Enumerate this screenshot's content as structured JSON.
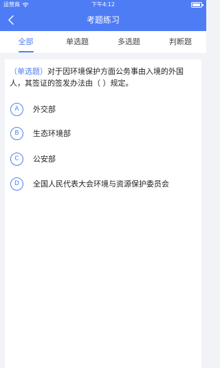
{
  "status_bar": {
    "carrier": "运营商",
    "time": "下午4:12"
  },
  "nav": {
    "title": "考题练习"
  },
  "tabs": [
    {
      "label": "全部",
      "active": true
    },
    {
      "label": "单选题",
      "active": false
    },
    {
      "label": "多选题",
      "active": false
    },
    {
      "label": "判断题",
      "active": false
    }
  ],
  "question": {
    "type": "（单选题）",
    "text": "对于因环境保护方面公务事由入境的外国人，其签证的签发办法由（ ）规定。"
  },
  "options": [
    {
      "letter": "A",
      "text": "外交部"
    },
    {
      "letter": "B",
      "text": "生态环境部"
    },
    {
      "letter": "C",
      "text": "公安部"
    },
    {
      "letter": "D",
      "text": "全国人民代表大会环境与资源保护委员会"
    }
  ],
  "colors": {
    "accent": "#4d7cf5",
    "background": "#f1f3f7"
  },
  "icons": {
    "back": "chevron-left-icon",
    "wifi": "wifi-icon",
    "battery": "battery-icon"
  }
}
